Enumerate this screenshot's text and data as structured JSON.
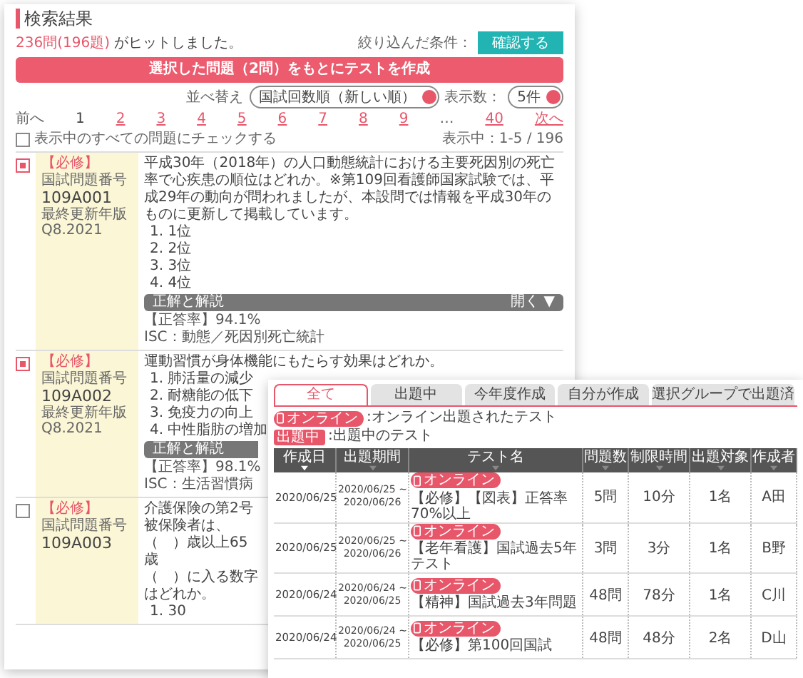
{
  "search_results": {
    "title": "検索結果",
    "hit_count": "236問(196題)",
    "hit_suffix": "がヒットしました。",
    "filter_label": "絞り込んだ条件：",
    "filter_button": "確認する",
    "create_button": "選択した問題（2問）をもとにテストを作成",
    "sort_label": "並べ替え",
    "sort_value": "国試回数順（新しい順）",
    "per_page_label": "表示数：",
    "per_page_value": "5件",
    "pagination": [
      {
        "label": "前へ",
        "selected": false,
        "kind": "text"
      },
      {
        "label": "1",
        "selected": true,
        "kind": "link"
      },
      {
        "label": "2",
        "selected": false,
        "kind": "link"
      },
      {
        "label": "3",
        "selected": false,
        "kind": "link"
      },
      {
        "label": "4",
        "selected": false,
        "kind": "link"
      },
      {
        "label": "5",
        "selected": false,
        "kind": "link"
      },
      {
        "label": "6",
        "selected": false,
        "kind": "link"
      },
      {
        "label": "7",
        "selected": false,
        "kind": "link"
      },
      {
        "label": "8",
        "selected": false,
        "kind": "link"
      },
      {
        "label": "9",
        "selected": false,
        "kind": "link"
      },
      {
        "label": "…",
        "selected": false,
        "kind": "text"
      },
      {
        "label": "40",
        "selected": false,
        "kind": "link"
      },
      {
        "label": "次へ",
        "selected": false,
        "kind": "link"
      }
    ],
    "check_all": {
      "label": "表示中のすべての問題にチェックする",
      "checked": false
    },
    "range": "表示中：1-5 / 196",
    "items": [
      {
        "checked": true,
        "tag": "【必修】",
        "number_label": "国試問題番号",
        "number": "109A001",
        "updated_label": "最終更新年版",
        "updated": "Q8.2021",
        "question_lines": [
          "平成30年（2018年）の人口動態統計における主要死因別の死亡率で心疾患の順位はどれか。※第109回看護師国家試験では、平成29年の動向が問われましたが、本設問では情報を平成30年のものに更新して掲載しています。"
        ],
        "options": [
          "1.  1位",
          "2.  2位",
          "3.  3位",
          "4.  4位"
        ],
        "explain_label": "正解と解説",
        "explain_toggle": "開く ▼",
        "rate": "【正答率】94.1%",
        "category": "ISC：動態／死因別死亡統計"
      },
      {
        "checked": true,
        "tag": "【必修】",
        "number_label": "国試問題番号",
        "number": "109A002",
        "updated_label": "最終更新年版",
        "updated": "Q8.2021",
        "question_lines": [
          "運動習慣が身体機能にもたらす効果はどれか。"
        ],
        "options": [
          "1.  肺活量の減少",
          "2.  耐糖能の低下",
          "3.  免疫力の向上",
          "4.  中性脂肪の増加"
        ],
        "explain_label": "正解と解説",
        "rate": "【正答率】98.1%",
        "category": "ISC：生活習慣病"
      },
      {
        "checked": false,
        "tag": "【必修】",
        "number_label": "国試問題番号",
        "number": "109A003",
        "question_lines": [
          "介護保険の第2号被保険者は、（　）歳以上65歳",
          "（　）に入る数字はどれか。"
        ],
        "options": [
          "1.  30"
        ]
      }
    ]
  },
  "test_list": {
    "tabs": [
      {
        "label": "全て",
        "selected": true
      },
      {
        "label": "出題中",
        "selected": false
      },
      {
        "label": "今年度作成",
        "selected": false
      },
      {
        "label": "自分が作成",
        "selected": false
      },
      {
        "label": "選択グループで出題済",
        "selected": false
      }
    ],
    "legend": [
      {
        "kind": "online",
        "badge": "オンライン",
        "text": ":オンライン出題されたテスト"
      },
      {
        "kind": "active",
        "badge": "出題中",
        "text": ":出題中のテスト"
      }
    ],
    "columns": [
      {
        "label": "作成日",
        "sorted": true
      },
      {
        "label": "出題期間",
        "sorted": false
      },
      {
        "label": "テスト名",
        "sorted": false
      },
      {
        "label": "問題数",
        "sorted": false
      },
      {
        "label": "制限時間",
        "sorted": false
      },
      {
        "label": "出題対象",
        "sorted": false
      },
      {
        "label": "作成者",
        "sorted": false
      }
    ],
    "rows": [
      {
        "created": "2020/06/25",
        "period_start": "2020/06/25 ~",
        "period_end": "2020/06/26",
        "badge": "オンライン",
        "name": "【必修】【図表】正答率70%以上",
        "questions": "5問",
        "time": "10分",
        "target": "1名",
        "author": "A田"
      },
      {
        "created": "2020/06/25",
        "period_start": "2020/06/25 ~",
        "period_end": "2020/06/26",
        "badge": "オンライン",
        "name": "【老年看護】国試過去5年テスト",
        "questions": "3問",
        "time": "3分",
        "target": "1名",
        "author": "B野"
      },
      {
        "created": "2020/06/24",
        "period_start": "2020/06/24 ~",
        "period_end": "2020/06/25",
        "badge": "オンライン",
        "name": "【精神】国試過去3年問題",
        "questions": "48問",
        "time": "78分",
        "target": "1名",
        "author": "C川"
      },
      {
        "created": "2020/06/24",
        "period_start": "2020/06/24 ~",
        "period_end": "2020/06/25",
        "badge": "オンライン",
        "name": "【必修】第100回国試",
        "questions": "48問",
        "time": "48分",
        "target": "2名",
        "author": "D山"
      }
    ]
  }
}
